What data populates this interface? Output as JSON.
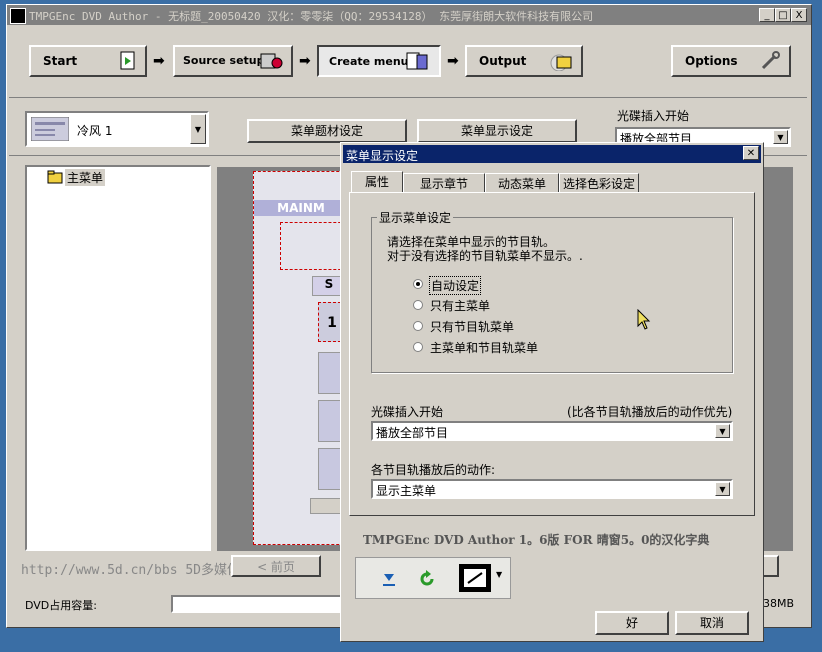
{
  "window": {
    "title": "TMPGEnc DVD Author - 无标题_20050420 汉化：零零柒（QQ：29534128） 东莞厚街朗大软件科技有限公司",
    "caption_buttons": [
      "_",
      "□",
      "X"
    ]
  },
  "steps": {
    "start": "Start",
    "source_setup": "Source setup",
    "create_menu": "Create menu",
    "output": "Output",
    "options": "Options"
  },
  "toolbar": {
    "theme_name": "冷风 1",
    "menu_material_btn": "菜单题材设定",
    "menu_display_btn": "菜单显示设定",
    "disc_insert_label": "光碟插入开始",
    "disc_insert_value": "播放全部节目"
  },
  "tree": {
    "root": "主菜单"
  },
  "preview": {
    "main_label": "MAINM",
    "sub_label": "S",
    "num_label": "1"
  },
  "bottom": {
    "watermark": "http://www.5d.cn/bbs 5D多媒体",
    "prev_btn": "< 前页",
    "capacity_label": "DVD占用容量:",
    "capacity_value": "38MB"
  },
  "dialog": {
    "title": "菜单显示设定",
    "tabs": [
      "属性",
      "显示章节",
      "动态菜单",
      "选择色彩设定"
    ],
    "group_title": "显示菜单设定",
    "desc_line1": "请选择在菜单中显示的节目轨。",
    "desc_line2": "对于没有选择的节目轨菜单不显示。.",
    "options": [
      "自动设定",
      "只有主菜单",
      "只有节目轨菜单",
      "主菜单和节目轨菜单"
    ],
    "selected_index": 0,
    "disc_insert_label": "光碟插入开始",
    "disc_insert_hint": "(比各节目轨播放后的动作优先)",
    "disc_insert_value": "播放全部节目",
    "after_play_label": "各节目轨播放后的动作:",
    "after_play_value": "显示主菜单",
    "credit": "TMPGEnc DVD Author 1。6版 FOR 晴窗5。0的汉化字典",
    "ok": "好",
    "cancel": "取消"
  }
}
